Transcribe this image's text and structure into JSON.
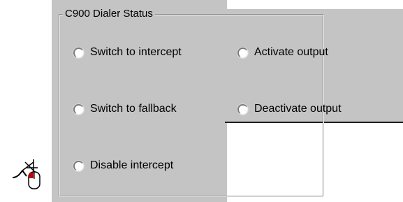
{
  "group": {
    "title": "C900 Dialer Status"
  },
  "options": {
    "switch_to_intercept": "Switch to intercept",
    "activate_output": "Activate output",
    "switch_to_fallback": "Switch to fallback",
    "deactivate_output": "Deactivate output",
    "disable_intercept": "Disable intercept"
  },
  "icons": {
    "cursor": "mouse-pointer-with-mouse-icon"
  },
  "colors": {
    "panel": "#c4c4c4",
    "background": "#ffffff"
  }
}
